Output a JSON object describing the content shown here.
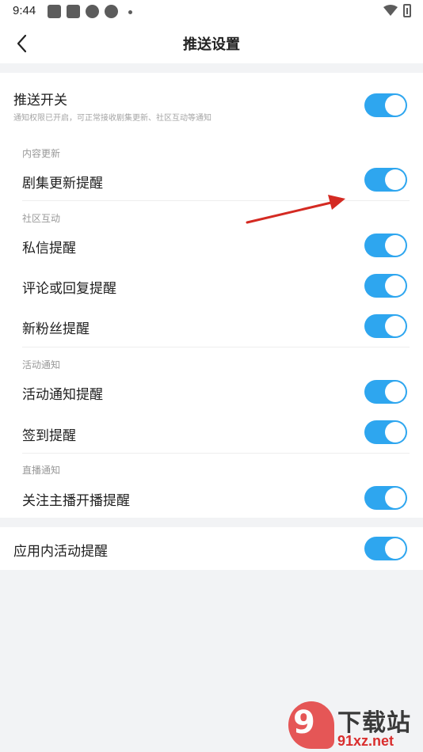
{
  "status_bar": {
    "time": "9:44",
    "notification_icons": [
      "app-icon",
      "app-icon",
      "sync-icon",
      "sync-icon",
      "more-dot-icon"
    ],
    "right_icons": [
      "wifi-icon",
      "battery-icon"
    ]
  },
  "nav": {
    "back_icon": "chevron-left-icon",
    "title": "推送设置"
  },
  "push_master": {
    "label": "推送开关",
    "hint": "通知权限已开启，可正常接收剧集更新、社区互动等通知",
    "enabled": true
  },
  "sections": [
    {
      "title": "内容更新",
      "items": [
        {
          "label": "剧集更新提醒",
          "enabled": true
        }
      ]
    },
    {
      "title": "社区互动",
      "items": [
        {
          "label": "私信提醒",
          "enabled": true
        },
        {
          "label": "评论或回复提醒",
          "enabled": true
        },
        {
          "label": "新粉丝提醒",
          "enabled": true
        }
      ]
    },
    {
      "title": "活动通知",
      "items": [
        {
          "label": "活动通知提醒",
          "enabled": true
        },
        {
          "label": "签到提醒",
          "enabled": true
        }
      ]
    },
    {
      "title": "直播通知",
      "items": [
        {
          "label": "关注主播开播提醒",
          "enabled": true
        }
      ]
    }
  ],
  "app_activity": {
    "label": "应用内活动提醒",
    "enabled": true
  },
  "colors": {
    "toggle_on": "#2ea6ef",
    "annotation_arrow": "#d42a22",
    "background": "#f2f3f5"
  },
  "watermark": {
    "logo_text": "9",
    "title": "下载站",
    "site": "91xz.net"
  }
}
